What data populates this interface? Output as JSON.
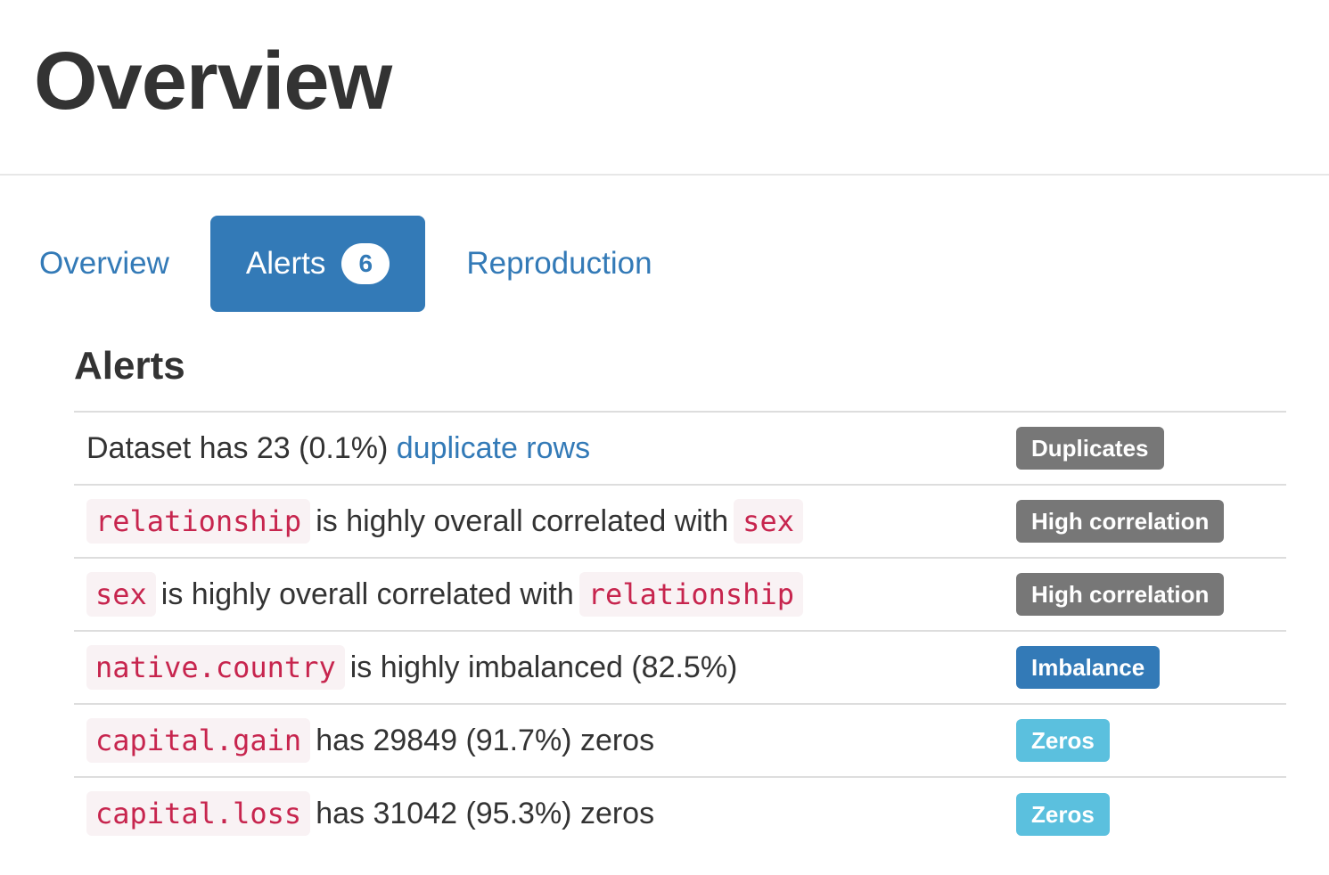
{
  "page_title": "Overview",
  "tabs": [
    {
      "label": "Overview",
      "active": false
    },
    {
      "label": "Alerts",
      "count": "6",
      "active": true
    },
    {
      "label": "Reproduction",
      "active": false
    }
  ],
  "section_title": "Alerts",
  "colors": {
    "primary": "#337ab7",
    "badge_default": "#777777",
    "badge_info": "#5bc0de",
    "code_text": "#c7254e",
    "code_bg": "#f9f2f4"
  },
  "alerts": [
    {
      "text_before": "Dataset has 23 (0.1%) ",
      "link": "duplicate rows",
      "badge": "Duplicates",
      "badge_color": "#777777"
    },
    {
      "var1": "relationship",
      "text": "is highly overall correlated with",
      "var2": "sex",
      "badge": "High correlation",
      "badge_color": "#777777"
    },
    {
      "var1": "sex",
      "text": "is highly overall correlated with",
      "var2": "relationship",
      "badge": "High correlation",
      "badge_color": "#777777"
    },
    {
      "var1": "native.country",
      "text": "is highly imbalanced (82.5%)",
      "badge": "Imbalance",
      "badge_color": "#337ab7"
    },
    {
      "var1": "capital.gain",
      "text": "has 29849 (91.7%) zeros",
      "badge": "Zeros",
      "badge_color": "#5bc0de"
    },
    {
      "var1": "capital.loss",
      "text": "has 31042 (95.3%) zeros",
      "badge": "Zeros",
      "badge_color": "#5bc0de"
    }
  ]
}
